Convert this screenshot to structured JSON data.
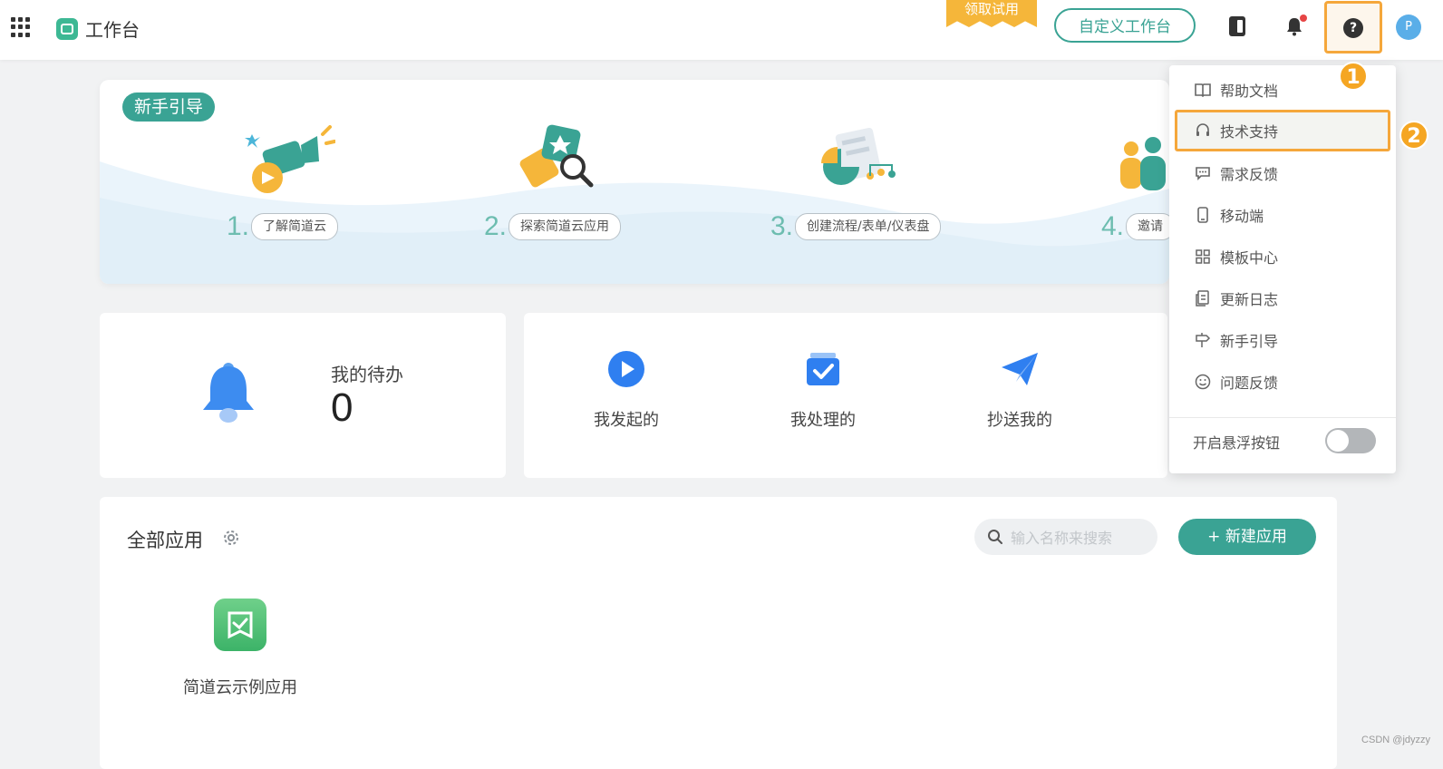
{
  "topbar": {
    "app_title": "工作台",
    "trial_label": "领取试用",
    "custom_button": "自定义工作台",
    "help_glyph": "?",
    "avatar_initial": "P"
  },
  "annotations": {
    "marker_1": "1",
    "marker_2": "2"
  },
  "guide": {
    "tag": "新手引导",
    "steps": [
      {
        "num": "1.",
        "label": "了解简道云"
      },
      {
        "num": "2.",
        "label": "探索简道云应用"
      },
      {
        "num": "3.",
        "label": "创建流程/表单/仪表盘"
      },
      {
        "num": "4.",
        "label": "邀请"
      }
    ]
  },
  "todo": {
    "label": "我的待办",
    "count": "0"
  },
  "flows": {
    "initiated": "我发起的",
    "handled": "我处理的",
    "cc": "抄送我的"
  },
  "apps": {
    "title": "全部应用",
    "search_placeholder": "输入名称来搜索",
    "new_button": "+ 新建应用",
    "items": [
      {
        "name": "简道云示例应用"
      }
    ]
  },
  "help_menu": {
    "items": [
      {
        "label": "帮助文档",
        "icon": "book-icon"
      },
      {
        "label": "技术支持",
        "icon": "headset-icon"
      },
      {
        "label": "需求反馈",
        "icon": "message-icon"
      },
      {
        "label": "移动端",
        "icon": "mobile-icon"
      },
      {
        "label": "模板中心",
        "icon": "grid-icon"
      },
      {
        "label": "更新日志",
        "icon": "log-icon"
      },
      {
        "label": "新手引导",
        "icon": "signpost-icon"
      },
      {
        "label": "问题反馈",
        "icon": "smile-icon"
      }
    ],
    "active_item": "技术支持",
    "toggle_label": "开启悬浮按钮",
    "toggle_on": false
  },
  "colors": {
    "accent": "#3aa394",
    "highlight": "#f5a73b",
    "trial": "#f5b63a"
  },
  "watermark": "CSDN @jdyzzy"
}
